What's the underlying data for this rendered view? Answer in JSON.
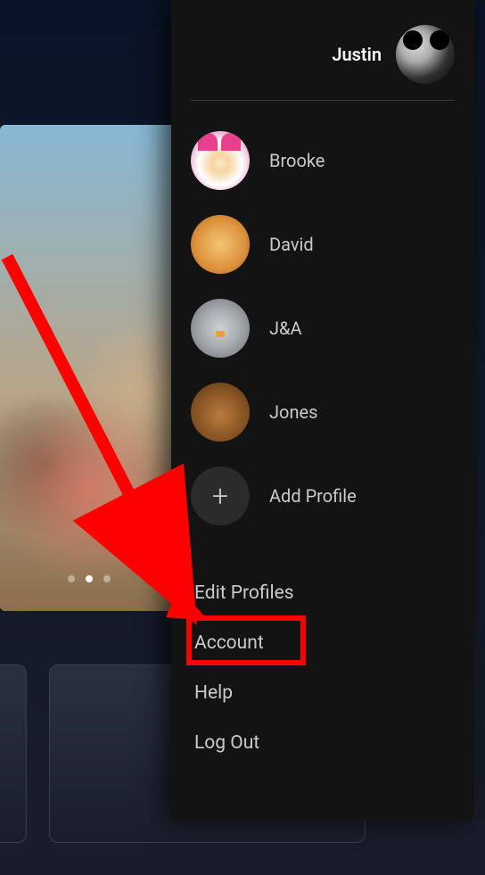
{
  "currentProfile": {
    "name": "Justin"
  },
  "profiles": [
    {
      "name": "Brooke"
    },
    {
      "name": "David"
    },
    {
      "name": "J&A"
    },
    {
      "name": "Jones"
    }
  ],
  "addProfileLabel": "Add Profile",
  "menu": {
    "editProfiles": "Edit Profiles",
    "account": "Account",
    "help": "Help",
    "logOut": "Log Out"
  },
  "highlighted": "account"
}
